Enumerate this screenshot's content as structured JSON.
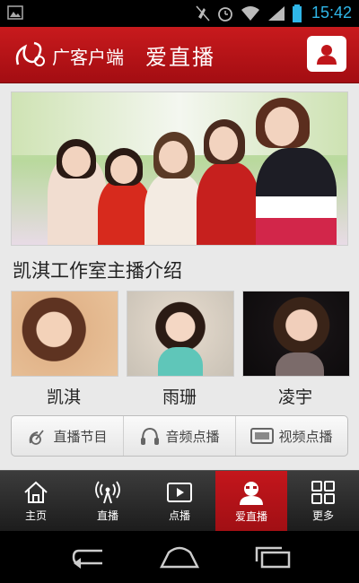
{
  "status_bar": {
    "time": "15:42",
    "icons": [
      "image-icon",
      "mute-icon",
      "alarm-icon",
      "wifi-icon",
      "signal-icon",
      "battery-icon"
    ]
  },
  "header": {
    "app_name": "广客户端",
    "page_title": "爱直播",
    "logo": "logo-icon",
    "user_button": "user-icon"
  },
  "section": {
    "title": "凯淇工作室主播介绍"
  },
  "hosts": [
    {
      "name": "凯淇"
    },
    {
      "name": "雨珊"
    },
    {
      "name": "凌宇"
    }
  ],
  "functions": [
    {
      "label": "直播节目",
      "icon": "satellite-icon"
    },
    {
      "label": "音频点播",
      "icon": "headphones-icon"
    },
    {
      "label": "视频点播",
      "icon": "film-icon"
    }
  ],
  "tabs": [
    {
      "label": "主页",
      "icon": "home-icon",
      "active": false
    },
    {
      "label": "直播",
      "icon": "broadcast-icon",
      "active": false
    },
    {
      "label": "点播",
      "icon": "play-icon",
      "active": false
    },
    {
      "label": "爱直播",
      "icon": "user-mask-icon",
      "active": true
    },
    {
      "label": "更多",
      "icon": "grid-icon",
      "active": false
    }
  ],
  "colors": {
    "brand_red": "#b8141a",
    "clock_blue": "#2fb6e8",
    "tabbar_dark": "#2a2a2a"
  }
}
